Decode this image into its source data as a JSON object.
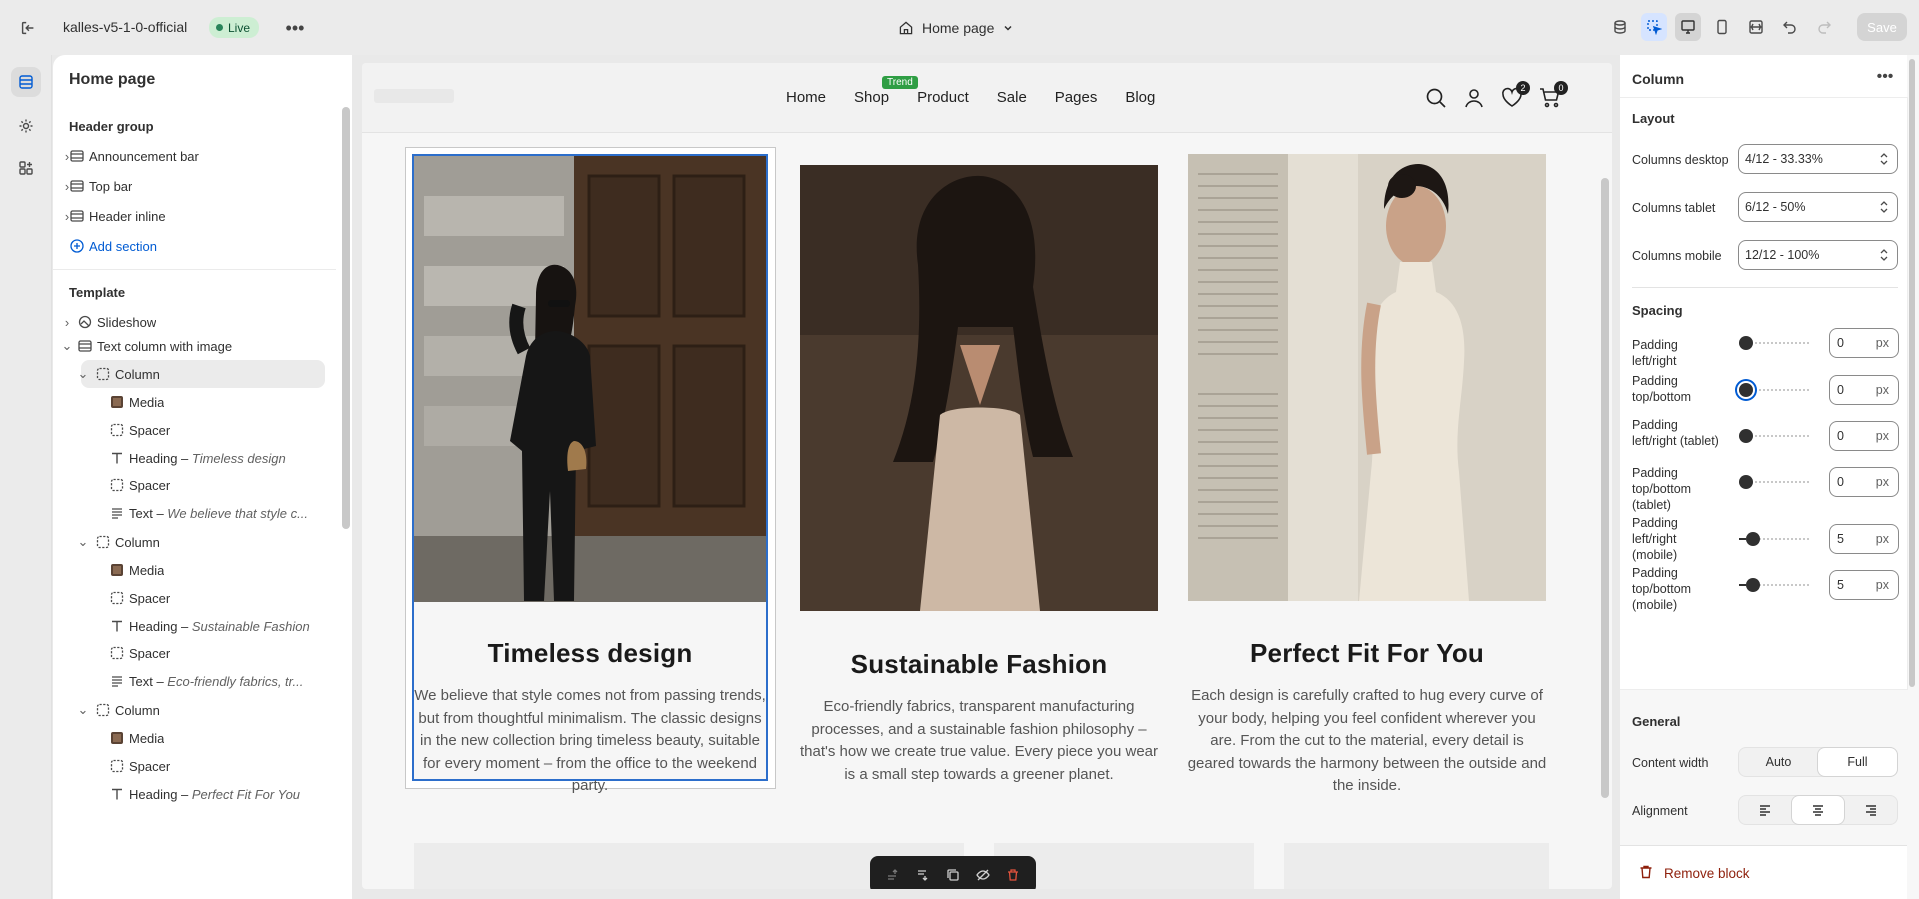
{
  "topbar": {
    "store_name": "kalles-v5-1-0-official",
    "status": "Live",
    "page_selector": "Home page",
    "save_label": "Save"
  },
  "left_panel": {
    "title": "Home page",
    "header_group_label": "Header group",
    "header_items": [
      "Announcement bar",
      "Top bar",
      "Header inline"
    ],
    "add_section": "Add section",
    "template_label": "Template",
    "template_items": [
      {
        "label": "Slideshow",
        "icon": "slideshow-icon"
      },
      {
        "label": "Text column with image",
        "icon": "section-icon"
      },
      {
        "label": "Column",
        "icon": "column-icon"
      },
      {
        "label": "Media",
        "icon": "media-thumbnail"
      },
      {
        "label": "Spacer",
        "icon": "spacer-icon"
      },
      {
        "label": "Heading – ",
        "em": "Timeless design",
        "icon": "text-icon"
      },
      {
        "label": "Spacer",
        "icon": "spacer-icon"
      },
      {
        "label": "Text – ",
        "em": "We believe that style c...",
        "icon": "paragraph-icon"
      },
      {
        "label": "Column",
        "icon": "column-icon"
      },
      {
        "label": "Media",
        "icon": "media-thumbnail"
      },
      {
        "label": "Spacer",
        "icon": "spacer-icon"
      },
      {
        "label": "Heading – ",
        "em": "Sustainable Fashion",
        "icon": "text-icon"
      },
      {
        "label": "Spacer",
        "icon": "spacer-icon"
      },
      {
        "label": "Text – ",
        "em": "Eco-friendly fabrics, tr...",
        "icon": "paragraph-icon"
      },
      {
        "label": "Column",
        "icon": "column-icon"
      },
      {
        "label": "Media",
        "icon": "media-thumbnail"
      },
      {
        "label": "Spacer",
        "icon": "spacer-icon"
      },
      {
        "label": "Heading – ",
        "em": "Perfect Fit For You",
        "icon": "text-icon"
      }
    ]
  },
  "preview": {
    "nav": [
      "Home",
      "Shop",
      "Product",
      "Sale",
      "Pages",
      "Blog"
    ],
    "trend_badge": "Trend",
    "wishlist_count": "2",
    "cart_count": "0",
    "columns": [
      {
        "heading": "Timeless design",
        "text": "We believe that style comes not from passing trends, but from thoughtful minimalism. The classic designs in the new collection bring timeless beauty, suitable for every moment – from the office to the weekend party."
      },
      {
        "heading": "Sustainable Fashion",
        "text": "Eco-friendly fabrics, transparent manufacturing processes, and a sustainable fashion philosophy – that's how we create true value. Every piece you wear is a small step towards a greener planet."
      },
      {
        "heading": "Perfect Fit For You",
        "text": "Each design is carefully crafted to hug every curve of your body, helping you feel confident wherever you are. From the cut to the material, every detail is geared towards the harmony between the outside and the inside."
      }
    ]
  },
  "right_panel": {
    "title": "Column",
    "layout_label": "Layout",
    "columns_desktop_label": "Columns desktop",
    "columns_desktop_value": "4/12 - 33.33%",
    "columns_tablet_label": "Columns tablet",
    "columns_tablet_value": "6/12 - 50%",
    "columns_mobile_label": "Columns mobile",
    "columns_mobile_value": "12/12 - 100%",
    "spacing_label": "Spacing",
    "padding": [
      {
        "label": "Padding left/right",
        "value": "0",
        "fraction": 0
      },
      {
        "label": "Padding top/bottom",
        "value": "0",
        "fraction": 0
      },
      {
        "label": "Padding left/right (tablet)",
        "value": "0",
        "fraction": 0
      },
      {
        "label": "Padding top/bottom (tablet)",
        "value": "0",
        "fraction": 0
      },
      {
        "label": "Padding left/right (mobile)",
        "value": "5",
        "fraction": 0.1
      },
      {
        "label": "Padding top/bottom (mobile)",
        "value": "5",
        "fraction": 0.1
      }
    ],
    "unit": "px",
    "general_label": "General",
    "content_width_label": "Content width",
    "content_width_options": [
      "Auto",
      "Full"
    ],
    "content_width_selected": "Full",
    "alignment_label": "Alignment",
    "remove_block": "Remove block"
  },
  "colors": {
    "accent": "#005bd3",
    "live_badge_bg": "#cdeed3",
    "trend_badge": "#2f9e44",
    "remove": "#8e1f0b"
  }
}
